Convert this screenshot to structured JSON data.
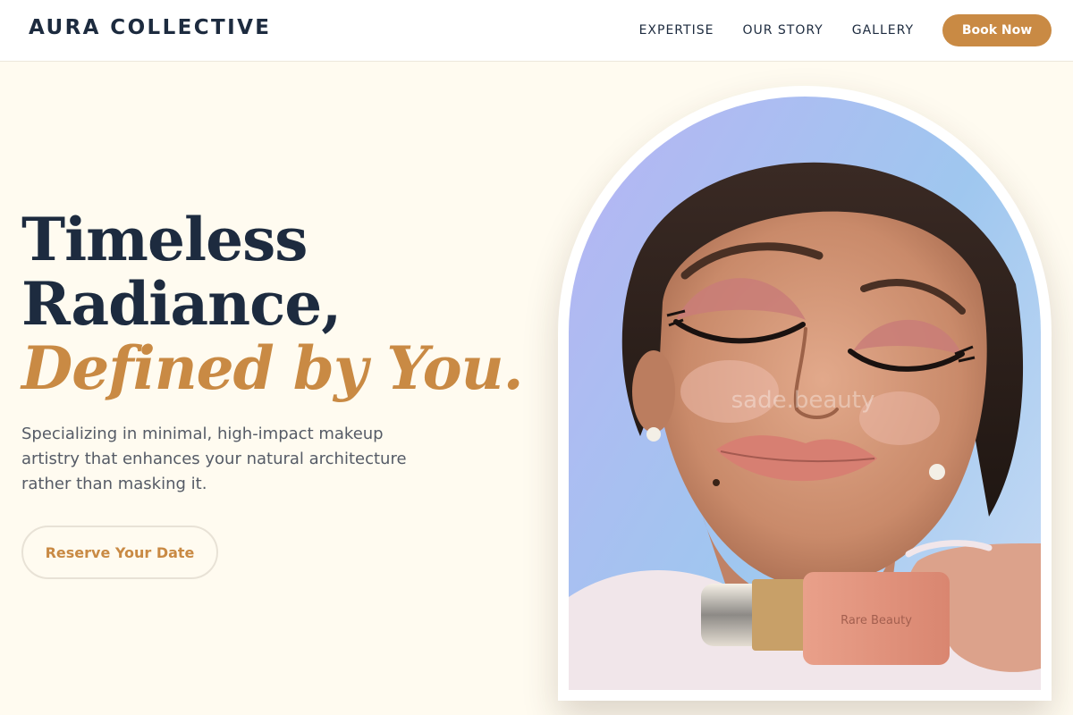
{
  "header": {
    "brand": "AURA COLLECTIVE",
    "nav": [
      "EXPERTISE",
      "OUR STORY",
      "GALLERY"
    ],
    "cta": "Book Now"
  },
  "hero": {
    "title_line1": "Timeless",
    "title_line2": "Radiance,",
    "title_line3": "Defined by You.",
    "subtitle": "Specializing in minimal, high-impact makeup artistry that enhances your natural architecture rather than masking it.",
    "button": "Reserve Your Date"
  },
  "colors": {
    "background": "#fffbf0",
    "navy": "#1d2b3f",
    "accent": "#c98a44",
    "body_text": "#555b66"
  },
  "photo": {
    "watermark": "sade.beauty",
    "product_label": "Rare Beauty"
  }
}
